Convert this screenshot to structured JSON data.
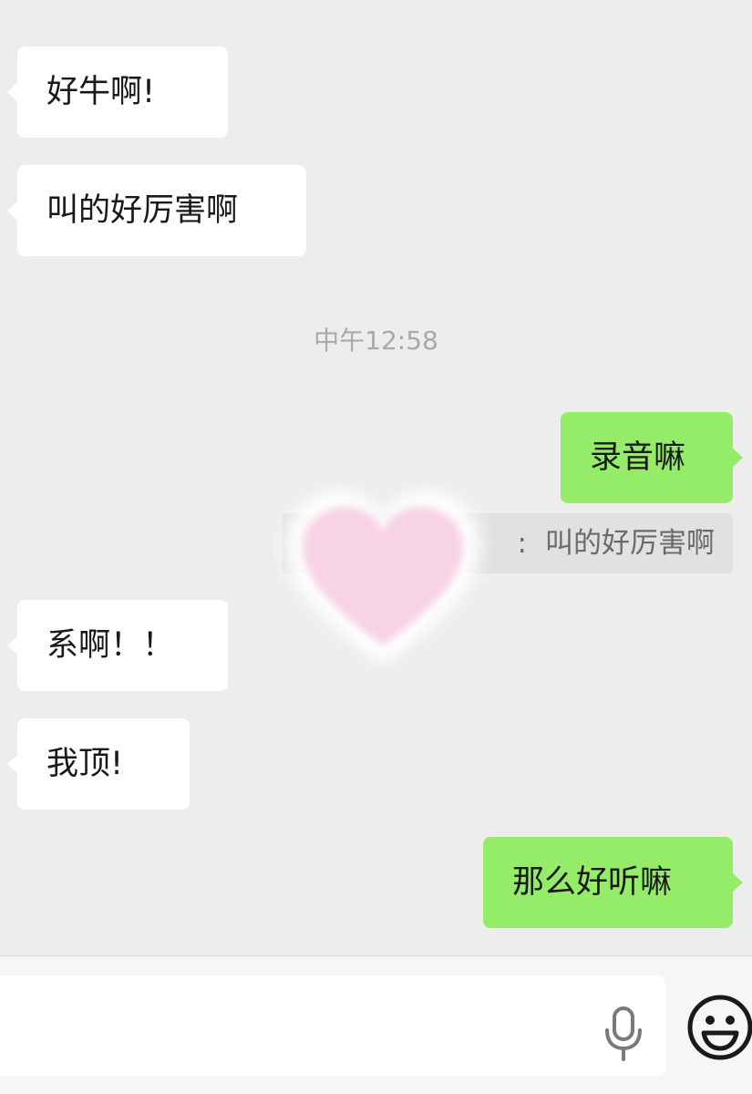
{
  "messages": [
    {
      "side": "in",
      "text": "好牛啊!"
    },
    {
      "side": "in",
      "text": "叫的好厉害啊"
    },
    {
      "side": "out",
      "text": "录音嘛"
    },
    {
      "side": "in",
      "text": "系啊！！"
    },
    {
      "side": "in",
      "text": "我顶!"
    },
    {
      "side": "out",
      "text": "那么好听嘛"
    }
  ],
  "timestamp": "中午12:58",
  "quote": {
    "separator": ":",
    "text": "叫的好厉害啊"
  },
  "sticker": {
    "icon": "heart-icon",
    "color": "#f8d3e6"
  },
  "input_bar": {
    "value": "",
    "mic_icon": "microphone-icon",
    "emoji_icon": "smiley-face-icon"
  },
  "colors": {
    "background": "#ededed",
    "incoming_bubble": "#ffffff",
    "outgoing_bubble": "#95ec69",
    "timestamp_text": "#a9a9a9"
  }
}
